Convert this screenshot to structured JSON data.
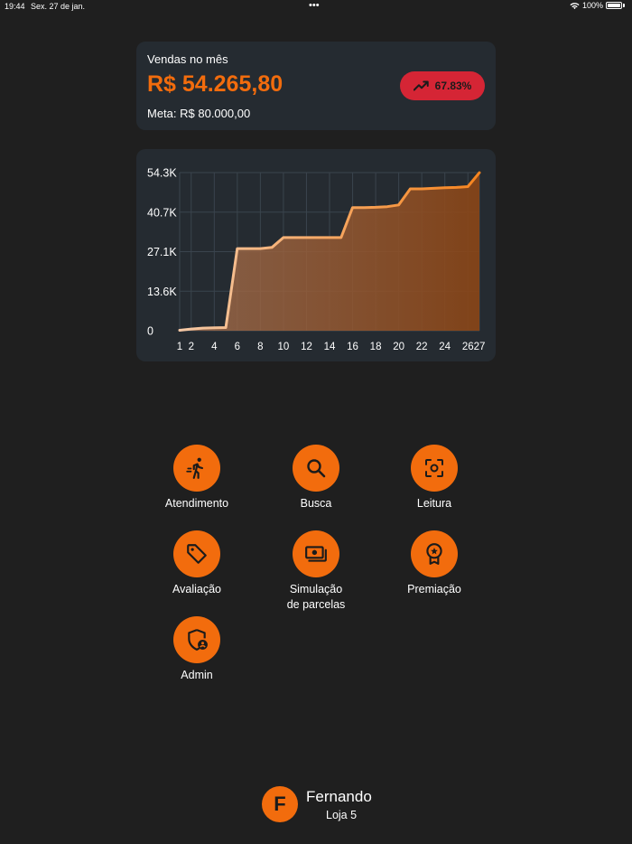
{
  "status_bar": {
    "time": "19:44",
    "date": "Sex. 27 de jan.",
    "dots": "•••",
    "battery": "100%"
  },
  "sales": {
    "label": "Vendas no mês",
    "value": "R$ 54.265,80",
    "goal": "Meta: R$ 80.000,00",
    "growth": "67.83%",
    "growth_icon": "trending-up-icon"
  },
  "colors": {
    "accent": "#f26c0d",
    "badge": "#d52535",
    "card": "#252b31",
    "background": "#1f1f1f"
  },
  "chart_data": {
    "type": "area",
    "x": [
      1,
      2,
      3,
      4,
      5,
      6,
      7,
      8,
      9,
      10,
      11,
      12,
      13,
      14,
      15,
      16,
      17,
      18,
      19,
      20,
      21,
      22,
      23,
      24,
      25,
      26,
      27
    ],
    "values": [
      150,
      600,
      900,
      1000,
      1100,
      28200,
      28200,
      28200,
      28600,
      32000,
      32000,
      32000,
      32000,
      32000,
      32000,
      42300,
      42300,
      42400,
      42600,
      43200,
      48700,
      48700,
      48900,
      49100,
      49200,
      49500,
      54265.8
    ],
    "x_ticks": [
      "1",
      "2",
      "4",
      "6",
      "8",
      "10",
      "12",
      "14",
      "16",
      "18",
      "20",
      "22",
      "24",
      "26",
      "27"
    ],
    "y_ticks": [
      "0",
      "13.6K",
      "27.1K",
      "40.7K",
      "54.3K"
    ],
    "ylim": [
      0,
      54300
    ],
    "xlim": [
      1,
      27
    ],
    "grid": true
  },
  "menu": [
    {
      "label": "Atendimento",
      "icon": "running-person-icon"
    },
    {
      "label": "Busca",
      "icon": "search-icon"
    },
    {
      "label": "Leitura",
      "icon": "scan-icon"
    },
    {
      "label": "Avaliação",
      "icon": "tag-icon"
    },
    {
      "label": "Simulação\nde parcelas",
      "icon": "money-icon"
    },
    {
      "label": "Premiação",
      "icon": "award-icon"
    },
    {
      "label": "Admin",
      "icon": "admin-shield-icon"
    }
  ],
  "user": {
    "initial": "F",
    "name": "Fernando",
    "store": "Loja 5"
  }
}
